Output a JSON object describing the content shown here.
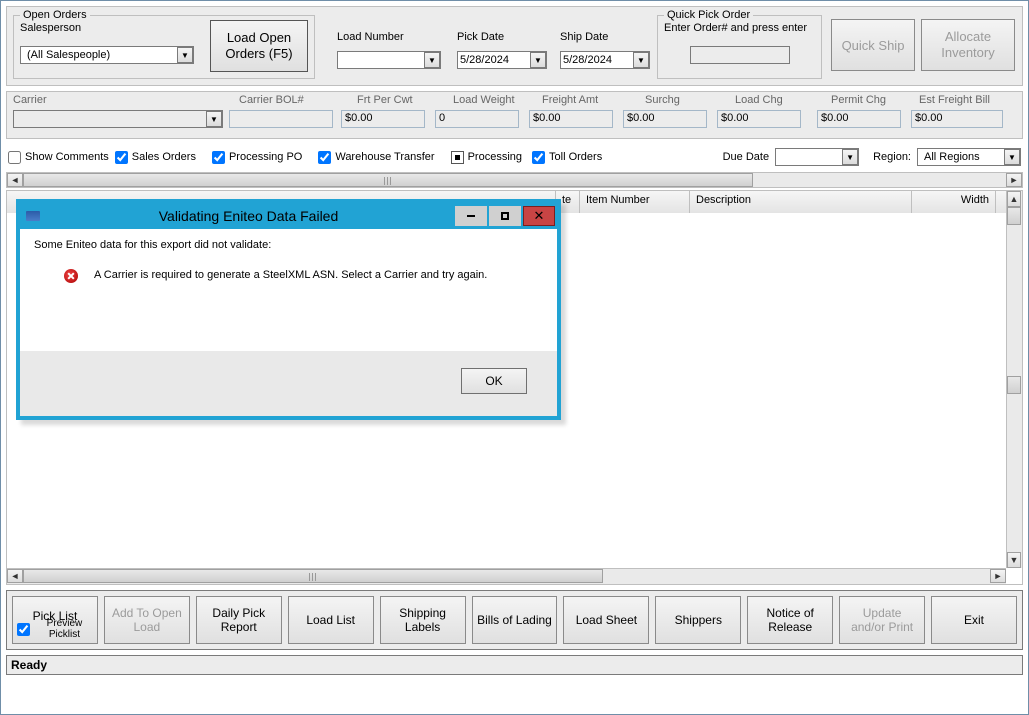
{
  "open_orders": {
    "legend": "Open Orders",
    "salesperson_label": "Salesperson",
    "salesperson_value": "(All Salespeople)",
    "load_btn_l1": "Load Open",
    "load_btn_l2": "Orders (F5)"
  },
  "load": {
    "number_label": "Load Number",
    "number_value": ""
  },
  "pick_date": {
    "label": "Pick Date",
    "value": "5/28/2024"
  },
  "ship_date": {
    "label": "Ship Date",
    "value": "5/28/2024"
  },
  "quick_pick": {
    "legend": "Quick Pick Order",
    "hint": "Enter Order# and press enter",
    "value": ""
  },
  "quick_ship_label": "Quick Ship",
  "allocate_l1": "Allocate",
  "allocate_l2": "Inventory",
  "carrier_panel": {
    "carrier_label": "Carrier",
    "carrier_value": "",
    "bol_label": "Carrier BOL#",
    "bol_value": "",
    "frt_cwt_label": "Frt Per Cwt",
    "frt_cwt_value": "$0.00",
    "load_weight_label": "Load Weight",
    "load_weight_value": "0",
    "freight_amt_label": "Freight Amt",
    "freight_amt_value": "$0.00",
    "surchg_label": "Surchg",
    "surchg_value": "$0.00",
    "load_chg_label": "Load Chg",
    "load_chg_value": "$0.00",
    "permit_chg_label": "Permit Chg",
    "permit_chg_value": "$0.00",
    "est_freight_label": "Est Freight Bill",
    "est_freight_value": "$0.00"
  },
  "filters": {
    "show_comments": {
      "label": "Show Comments",
      "checked": false
    },
    "sales_orders": {
      "label": "Sales Orders",
      "checked": true
    },
    "processing_po": {
      "label": "Processing PO",
      "checked": true
    },
    "wh_transfer": {
      "label": "Warehouse Transfer",
      "checked": true
    },
    "processing": {
      "label": "Processing",
      "checked": "mixed"
    },
    "toll_orders": {
      "label": "Toll Orders",
      "checked": true
    },
    "due_date_label": "Due Date",
    "due_date_value": "",
    "region_label": "Region:",
    "region_value": "All Regions"
  },
  "grid": {
    "columns": [
      "",
      "te",
      "Item Number",
      "Description",
      "Width"
    ]
  },
  "bottom_buttons": {
    "pick_list": "Pick List",
    "preview_picklist_label": "Preview Picklist",
    "preview_picklist_checked": true,
    "add_to_open_load": "Add To Open Load",
    "daily_pick_report": "Daily Pick Report",
    "load_list": "Load List",
    "shipping_labels": "Shipping Labels",
    "bills_of_lading": "Bills of Lading",
    "load_sheet": "Load Sheet",
    "shippers": "Shippers",
    "notice_of_release": "Notice of Release",
    "update_print": "Update and/or Print",
    "exit": "Exit"
  },
  "status": "Ready",
  "dialog": {
    "title": "Validating Eniteo Data Failed",
    "msg_main": "Some Eniteo data for this export did not validate:",
    "msg_detail": "A Carrier is required to generate a SteelXML ASN. Select a Carrier and try again.",
    "ok": "OK"
  }
}
